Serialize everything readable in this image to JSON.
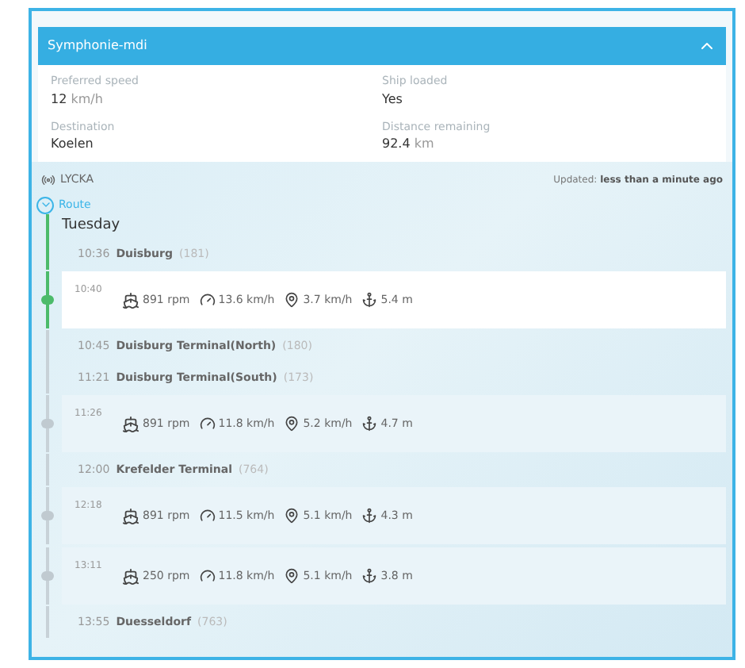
{
  "header": {
    "title": "Symphonie-mdi",
    "expanded": true
  },
  "info": [
    {
      "label": "Preferred speed",
      "value": "12",
      "unit": "km/h"
    },
    {
      "label": "Ship loaded",
      "value": "Yes"
    },
    {
      "label": "Destination",
      "value": "Koelen"
    },
    {
      "label": "Distance remaining",
      "value": "92.4",
      "unit": "km"
    }
  ],
  "location": {
    "name": "LYCKA",
    "updated_label": "Updated:",
    "updated_value": "less than a minute ago"
  },
  "route": {
    "label": "Route",
    "day": "Tuesday",
    "entries": [
      {
        "kind": "stop",
        "time": "10:36",
        "name": "Duisburg",
        "count": "(181)"
      },
      {
        "kind": "measure",
        "time": "10:40",
        "rpm": "891 rpm",
        "speed": "13.6 km/h",
        "current": "3.7 km/h",
        "depth": "5.4 m",
        "selected": true
      },
      {
        "kind": "stop",
        "time": "10:45",
        "name": "Duisburg Terminal(North)",
        "count": "(180)"
      },
      {
        "kind": "stop",
        "time": "11:21",
        "name": "Duisburg Terminal(South)",
        "count": "(173)"
      },
      {
        "kind": "measure",
        "time": "11:26",
        "rpm": "891 rpm",
        "speed": "11.8 km/h",
        "current": "5.2 km/h",
        "depth": "4.7 m",
        "selected": false
      },
      {
        "kind": "stop",
        "time": "12:00",
        "name": "Krefelder Terminal",
        "count": "(764)"
      },
      {
        "kind": "measure",
        "time": "12:18",
        "rpm": "891 rpm",
        "speed": "11.5 km/h",
        "current": "5.1 km/h",
        "depth": "4.3 m",
        "selected": false
      },
      {
        "kind": "measure",
        "time": "13:11",
        "rpm": "250 rpm",
        "speed": "11.8 km/h",
        "current": "5.1 km/h",
        "depth": "3.8 m",
        "selected": false
      },
      {
        "kind": "stop",
        "time": "13:55",
        "name": "Duesseldorf",
        "count": "(763)"
      }
    ]
  }
}
